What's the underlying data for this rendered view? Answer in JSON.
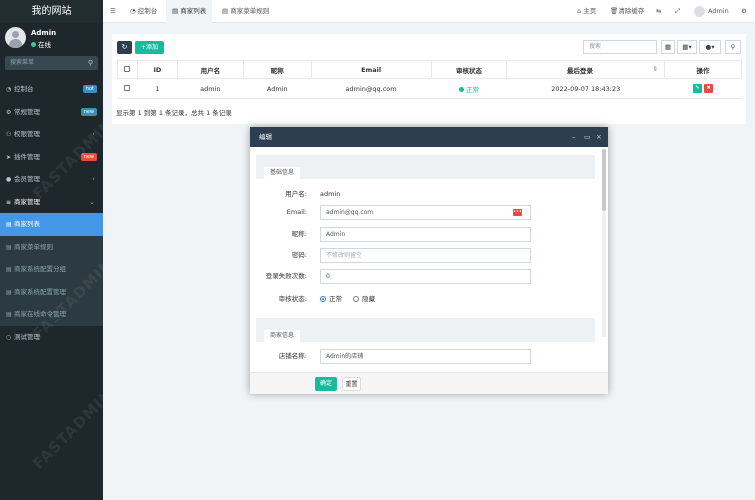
{
  "brand": "我的网站",
  "user": {
    "name": "Admin",
    "status": "在线"
  },
  "sidebar": {
    "search_placeholder": "搜索菜单",
    "items": [
      {
        "label": "控制台",
        "icon": "dashboard-icon",
        "badge": "hot",
        "badge_color": "#3c8dbc"
      },
      {
        "label": "常规管理",
        "icon": "cogs-icon",
        "badge": "new",
        "badge_color": "#3c8dbc"
      },
      {
        "label": "权限管理",
        "icon": "group-icon",
        "chevron": "‹"
      },
      {
        "label": "插件管理",
        "icon": "rocket-icon",
        "badge": "new",
        "badge_color": "#e74c3c"
      },
      {
        "label": "会员管理",
        "icon": "user-icon",
        "chevron": "‹"
      },
      {
        "label": "商家管理",
        "icon": "list-icon",
        "chevron": "⌄"
      }
    ],
    "subitems": [
      {
        "label": "商家列表",
        "active": true
      },
      {
        "label": "商家菜单规则",
        "active": false
      },
      {
        "label": "商家系统配置分组",
        "active": false
      },
      {
        "label": "商家系统配置管理",
        "active": false
      },
      {
        "label": "商家在线命令管理",
        "active": false
      }
    ],
    "last_item": {
      "label": "测试管理",
      "icon": "circle-icon"
    }
  },
  "topbar": {
    "tabs": [
      "控制台",
      "商家列表",
      "商家菜单规则"
    ],
    "home": "主页",
    "clear_cache": "清除缓存",
    "admin": "Admin"
  },
  "toolbar": {
    "add_label": "添加",
    "search_placeholder": "搜索"
  },
  "table": {
    "headers": [
      "ID",
      "用户名",
      "昵称",
      "Email",
      "审核状态",
      "最后登录",
      "操作"
    ],
    "rows": [
      {
        "id": "1",
        "username": "admin",
        "nickname": "Admin",
        "email": "admin@qq.com",
        "status": "正常",
        "last_login": "2022-09-07 18:43:23"
      }
    ],
    "pager_info": "显示第 1 到第 1 条记录，总共 1 条记录"
  },
  "watermark": "FASTADMIN",
  "modal": {
    "title": "编辑",
    "section1": "基础信息",
    "section2": "商家信息",
    "fields": {
      "username_label": "用户名:",
      "username_value": "admin",
      "email_label": "Email:",
      "email_value": "admin@qq.com",
      "nickname_label": "昵称:",
      "nickname_value": "Admin",
      "password_label": "密码:",
      "password_placeholder": "不修改则留空",
      "loginfail_label": "登录失败次数:",
      "loginfail_value": "0",
      "status_label": "审核状态:",
      "status_normal": "正常",
      "status_hidden": "隐藏",
      "shop_label": "店铺名称:",
      "shop_value": "Admin的店铺"
    },
    "ok_label": "确定",
    "reset_label": "重置"
  },
  "colors": {
    "sidebar": "#1e282c",
    "accent": "#18bc9c",
    "active": "#4397e6",
    "header": "#2c3e50"
  }
}
